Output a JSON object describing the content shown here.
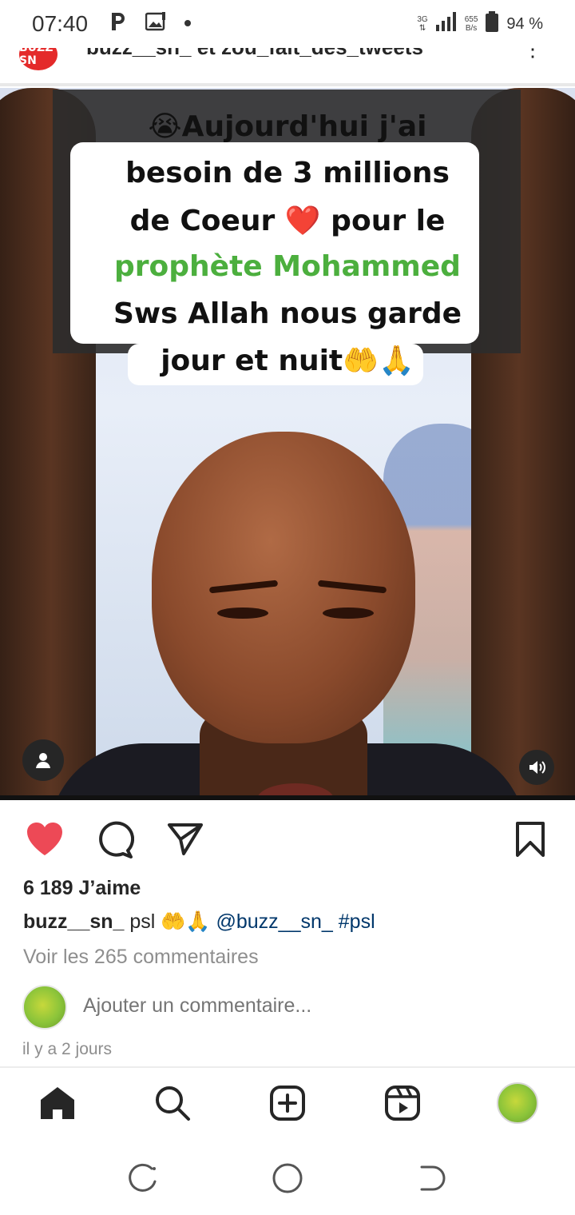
{
  "status_bar": {
    "time": "07:40",
    "network_type": "3G",
    "net_speed_value": "655",
    "net_speed_unit": "B/s",
    "battery": "94 %",
    "icons": [
      "parking-icon",
      "image-notification-icon",
      "dot-icon",
      "signal-icon",
      "battery-icon"
    ]
  },
  "post_header": {
    "avatar_text": "BUZZ SN",
    "title": "buzz__sn_ et zou_fait_des_tweets",
    "more_icon": "more-vertical-icon"
  },
  "post_image": {
    "caption_lines": [
      "😭Aujourd'hui j'ai",
      "besoin de 3 millions",
      "de Coeur ❤️ pour le",
      "prophète Mohammed",
      "Sws Allah nous garde",
      "jour et nuit🤲🙏"
    ],
    "caption_highlight_color": "#4caf3e",
    "user_tag_icon": "user-tag-icon",
    "sound_icon": "sound-on-icon"
  },
  "actions": {
    "like_icon": "heart-filled-icon",
    "like_color": "#ed4956",
    "comment_icon": "comment-icon",
    "share_icon": "send-icon",
    "save_icon": "bookmark-icon"
  },
  "post": {
    "likes": "6 189 J’aime",
    "caption_user": "buzz__sn_",
    "caption_text": " psl 🤲🙏 ",
    "caption_mention": "@buzz__sn_",
    "caption_hashtag": "#psl",
    "view_comments": "Voir les 265 commentaires",
    "comment_placeholder": "Ajouter un commentaire...",
    "timestamp": "il y a 2 jours"
  },
  "bottom_nav": {
    "items": [
      "home-icon",
      "search-icon",
      "new-post-icon",
      "reels-icon",
      "profile-avatar"
    ]
  },
  "system_nav": {
    "items": [
      "recents-icon",
      "home-circle-icon",
      "back-icon"
    ]
  }
}
